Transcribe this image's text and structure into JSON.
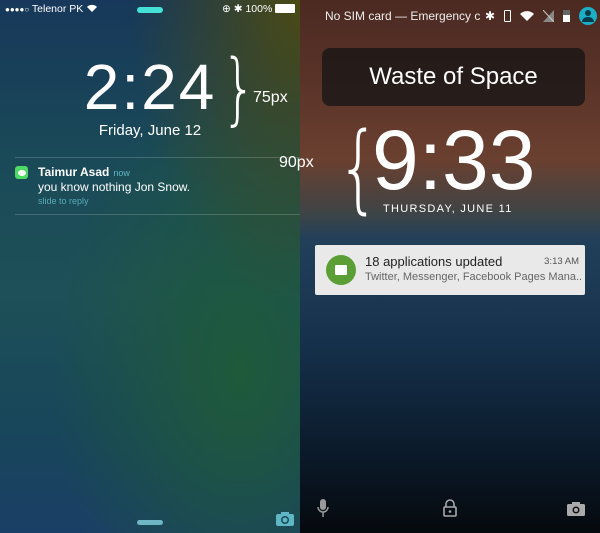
{
  "ios": {
    "status": {
      "signal_dots": "●●●●○",
      "carrier": "Telenor PK",
      "battery": "100%"
    },
    "time": "2:24",
    "date": "Friday, June 12",
    "notification": {
      "app_icon": "messages-icon",
      "sender": "Taimur Asad",
      "time": "now",
      "body": "you know nothing Jon Snow.",
      "action": "slide to reply"
    },
    "annotation": "75px",
    "accent": "#45e0d6"
  },
  "android": {
    "status": {
      "text": "No SIM card — Emergency c"
    },
    "owner_info": "Waste of Space",
    "time": "9:33",
    "date": "THURSDAY, JUNE 11",
    "notification": {
      "icon": "play-store-update-icon",
      "title": "18 applications updated",
      "time": "3:13 AM",
      "body": "Twitter, Messenger, Facebook Pages Mana.."
    },
    "annotation": "90px",
    "accent": "#1ab0c8"
  }
}
